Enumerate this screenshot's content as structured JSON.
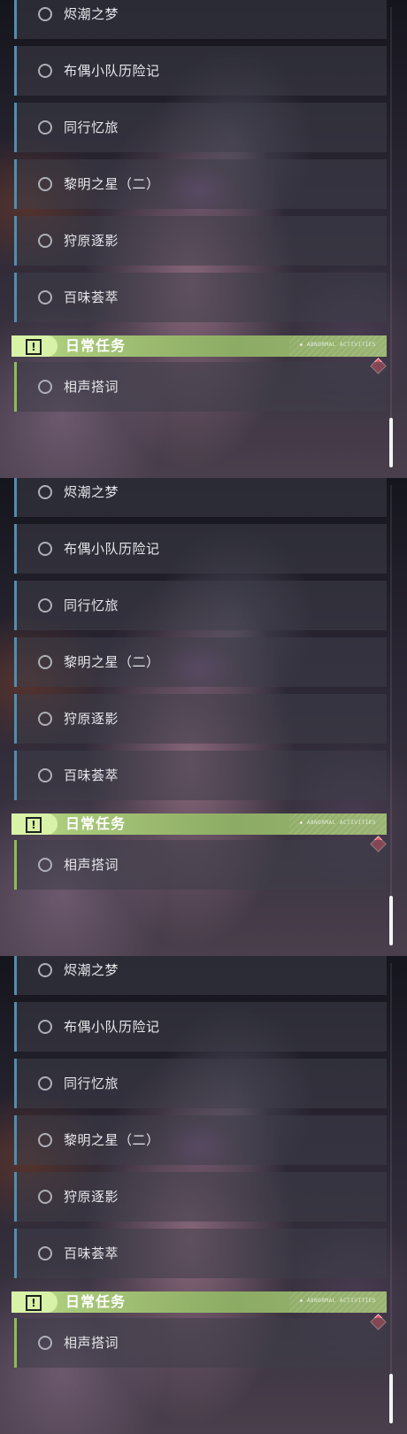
{
  "panels": [
    {
      "quests": [
        "烬潮之梦",
        "布偶小队历险记",
        "同行忆旅",
        "黎明之星（二）",
        "狩原逐影",
        "百味荟萃"
      ],
      "section": {
        "title": "日常任务",
        "tag": "◆ ABNORMAL ACTIVITIES"
      },
      "daily": [
        "相声搭词"
      ]
    },
    {
      "quests": [
        "烬潮之梦",
        "布偶小队历险记",
        "同行忆旅",
        "黎明之星（二）",
        "狩原逐影",
        "百味荟萃"
      ],
      "section": {
        "title": "日常任务",
        "tag": "◆ ABNORMAL ACTIVITIES"
      },
      "daily": [
        "相声搭词"
      ]
    },
    {
      "quests": [
        "烬潮之梦",
        "布偶小队历险记",
        "同行忆旅",
        "黎明之星（二）",
        "狩原逐影",
        "百味荟萃"
      ],
      "section": {
        "title": "日常任务",
        "tag": "◆ ABNORMAL ACTIVITIES"
      },
      "daily": [
        "相声搭词"
      ]
    }
  ],
  "icons": {
    "section": "warning-square-icon",
    "quest": "circle-icon",
    "marker": "diamond-marker-icon"
  },
  "colors": {
    "accent_green": "#c9e79b",
    "quest_border": "#5b8aa6",
    "daily_border": "#93b56a",
    "marker_red": "#d85263"
  }
}
